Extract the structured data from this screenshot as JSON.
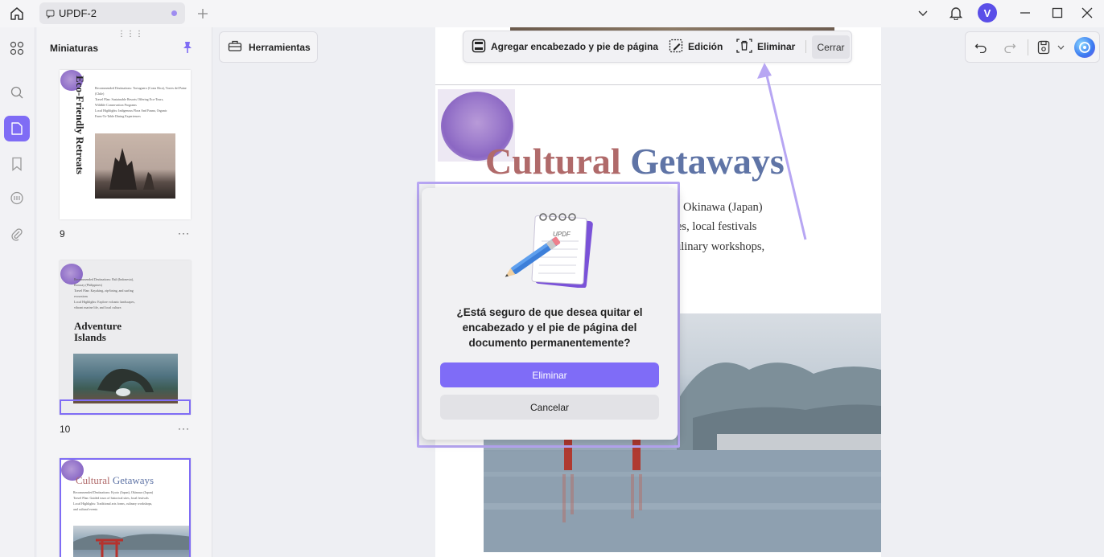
{
  "titlebar": {
    "tab_title": "UPDF-2",
    "avatar_initial": "V"
  },
  "thumbnails": {
    "title": "Miniaturas",
    "pages": [
      {
        "number": "9",
        "more": "···",
        "heading": "Eco-Friendly Retreats",
        "lines": [
          "Recommended Destinations: Tortuguero (Costa Rica), Torres del Paine (Chile)",
          "Travel Plan: Sustainable Resorts Offering Eco-Tours,",
          "Wildlife Conservation Programs",
          "Local Highlights: Indigenous Flora And Fauna, Organic",
          "Farm-To-Table Dining Experiences"
        ]
      },
      {
        "number": "10",
        "more": "···",
        "heading": "Adventure Islands",
        "lines": [
          "Recommended Destinations: Bali (Indonesia),",
          "Boracay (Philippines)",
          "Travel Plan: Kayaking, zip-lining, and surfing",
          "excursions",
          "Local Highlights: Explore volcanic landscapes,",
          "vibrant marine life, and local culture."
        ]
      },
      {
        "heading_a": "Cultural",
        "heading_b": "Getaways",
        "lines": [
          "Recommended Destinations: Kyoto (Japan), Okinawa (Japan)",
          "Travel Plan: Guided tours of historical sites, local festivals",
          "Local Highlights: Traditional arts forms, culinary workshops,",
          "and cultural events"
        ]
      }
    ]
  },
  "toolbar": {
    "tools_label": "Herramientas"
  },
  "header_footer_bar": {
    "add_label": "Agregar encabezado y pie de página",
    "edit_label": "Edición",
    "remove_label": "Eliminar",
    "close_label": "Cerrar"
  },
  "document": {
    "title_part1": "Cultural",
    "title_part2": "Getaways",
    "line1": "Okinawa (Japan)",
    "line2": "es, local festivals",
    "line3": "ulinary workshops,"
  },
  "dialog": {
    "message": "¿Está seguro de que desea quitar el encabezado y el pie de página del documento permanentemente?",
    "confirm_label": "Eliminar",
    "cancel_label": "Cancelar"
  },
  "colors": {
    "accent": "#7f6cf5",
    "title_red": "#b06a6a",
    "title_blue": "#5f74a6"
  }
}
